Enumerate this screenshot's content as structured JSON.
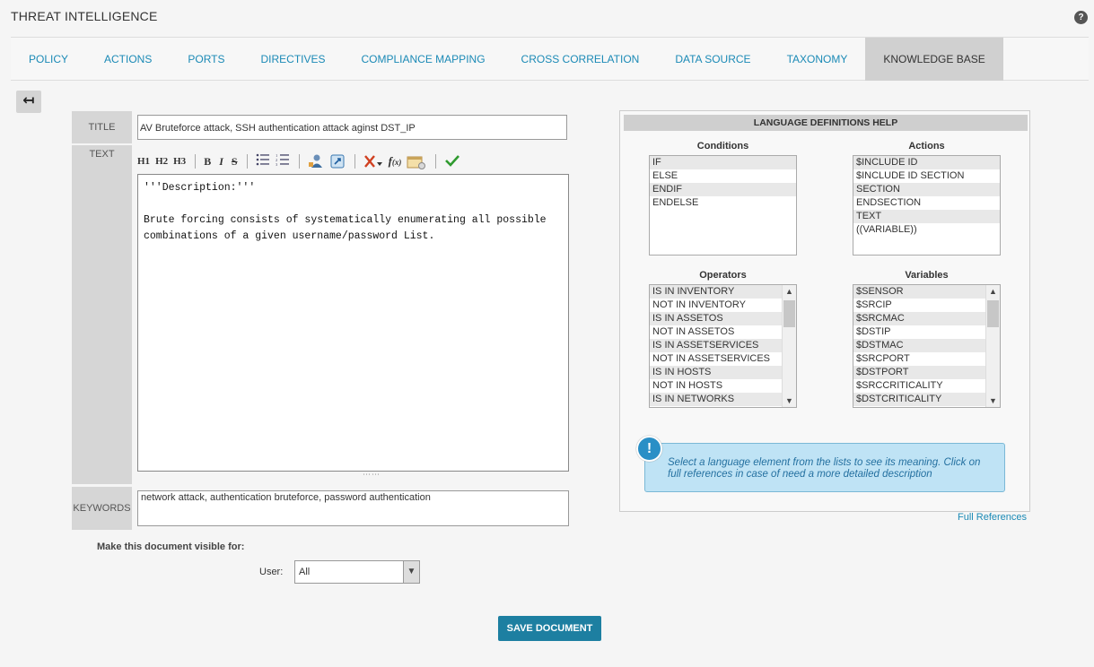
{
  "app": {
    "title": "THREAT INTELLIGENCE",
    "help_glyph": "?"
  },
  "tabs": [
    {
      "label": "POLICY",
      "active": false
    },
    {
      "label": "ACTIONS",
      "active": false
    },
    {
      "label": "PORTS",
      "active": false
    },
    {
      "label": "DIRECTIVES",
      "active": false
    },
    {
      "label": "COMPLIANCE MAPPING",
      "active": false
    },
    {
      "label": "CROSS CORRELATION",
      "active": false
    },
    {
      "label": "DATA SOURCE",
      "active": false
    },
    {
      "label": "TAXONOMY",
      "active": false
    },
    {
      "label": "KNOWLEDGE BASE",
      "active": true
    }
  ],
  "back_button": {
    "glyph": "↤",
    "icon": "back-arrow-icon"
  },
  "form": {
    "title_label": "TITLE",
    "title_value": "AV Bruteforce attack, SSH authentication attack aginst DST_IP",
    "text_label": "TEXT",
    "editor_lines": [
      "'''Description:'''",
      "",
      "Brute forcing consists of systematically enumerating all possible",
      "combinations of a given username/password List."
    ],
    "keywords_label": "KEYWORDS",
    "keywords_value": "network attack, authentication bruteforce, password authentication",
    "visible_label": "Make this document visible for:",
    "user_label": "User:",
    "user_value": "All",
    "save_label": "SAVE DOCUMENT"
  },
  "toolbar": {
    "h1": "H1",
    "h2": "H2",
    "h3": "H3",
    "bold": "B",
    "italic": "I",
    "strike": "S",
    "icons": [
      "bullet-list-icon",
      "numbered-list-icon",
      "user-link-icon",
      "link-icon",
      "tools-icon",
      "function-icon",
      "template-icon",
      "check-icon"
    ]
  },
  "help": {
    "header": "LANGUAGE DEFINITIONS HELP",
    "conditions": {
      "title": "Conditions",
      "items": [
        "IF",
        "ELSE",
        "ENDIF",
        "ENDELSE"
      ]
    },
    "actions": {
      "title": "Actions",
      "items": [
        "$INCLUDE ID",
        "$INCLUDE ID SECTION",
        "SECTION",
        "ENDSECTION",
        "TEXT",
        "((VARIABLE))"
      ]
    },
    "operators": {
      "title": "Operators",
      "items": [
        "IS IN INVENTORY",
        "NOT IN INVENTORY",
        "IS IN ASSETOS",
        "NOT IN ASSETOS",
        "IS IN ASSETSERVICES",
        "NOT IN ASSETSERVICES",
        "IS IN HOSTS",
        "NOT IN HOSTS",
        "IS IN NETWORKS"
      ]
    },
    "variables": {
      "title": "Variables",
      "items": [
        "$SENSOR",
        "$SRCIP",
        "$SRCMAC",
        "$DSTIP",
        "$DSTMAC",
        "$SRCPORT",
        "$DSTPORT",
        "$SRCCRITICALITY",
        "$DSTCRITICALITY"
      ]
    },
    "info_text": "Select a language element from the lists to see its meaning. Click on full references in case of need a more detailed description",
    "full_references": "Full References"
  },
  "colors": {
    "accent": "#1b8ab6",
    "save_button": "#1d7fa1",
    "info_bg": "#bfe3f5"
  }
}
